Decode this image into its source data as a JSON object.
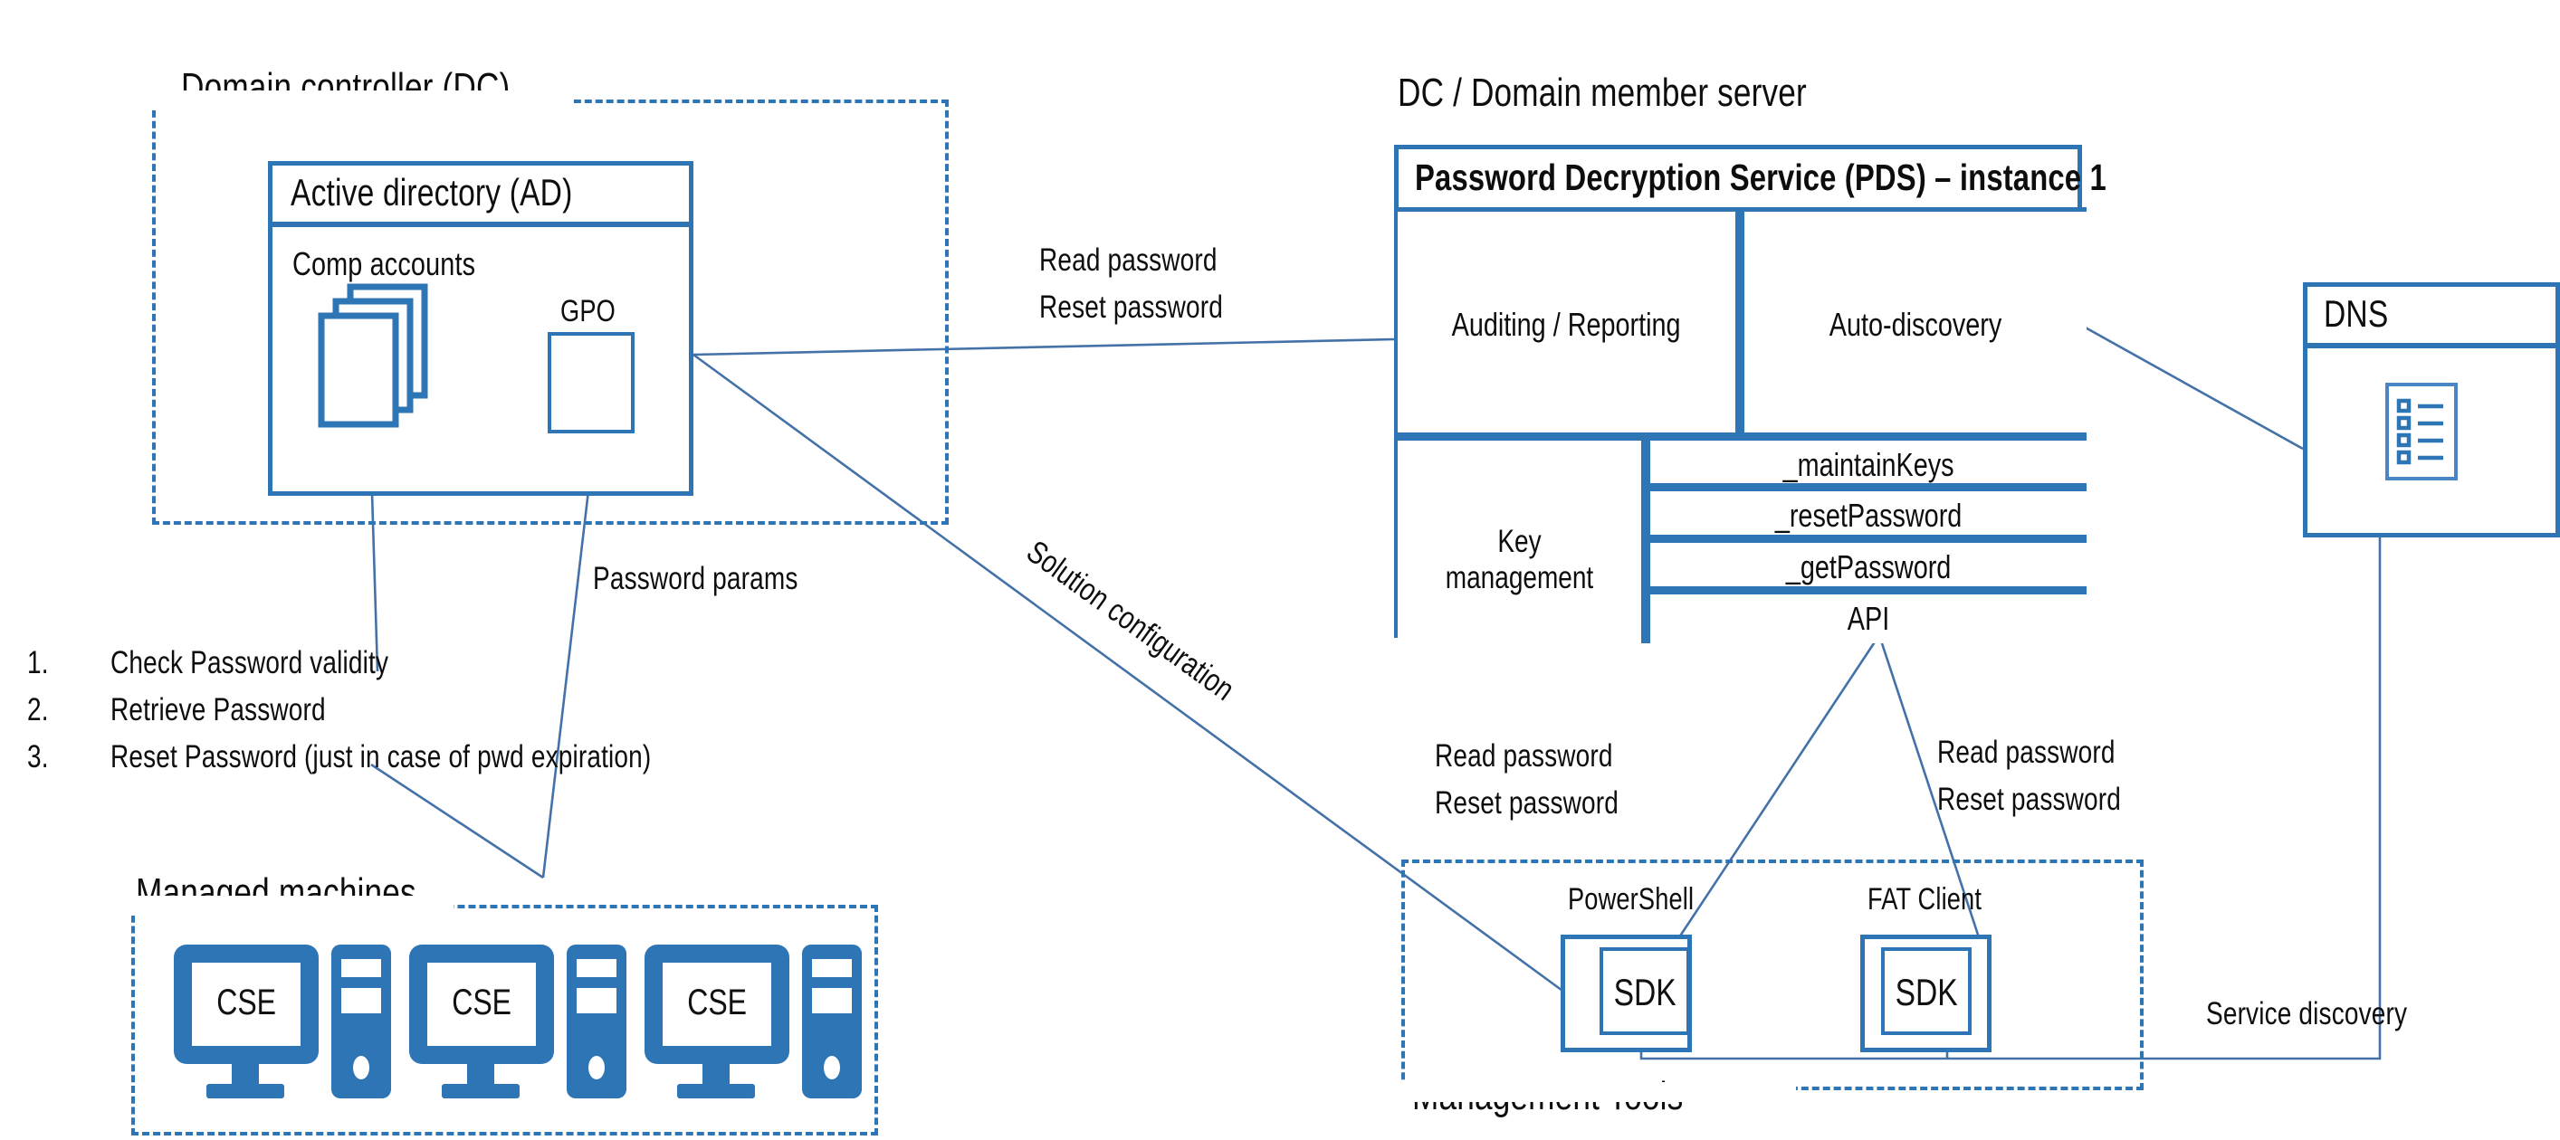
{
  "zones": {
    "domain_controller": {
      "title": "Domain controller (DC)"
    },
    "dc_member_server": {
      "title": "DC / Domain member server"
    },
    "managed_machines": {
      "title": "Managed machines"
    },
    "management_tools": {
      "title": "Management Tools"
    }
  },
  "active_directory": {
    "title": "Active directory (AD)",
    "comp_accounts_label": "Comp accounts",
    "gpo_label": "GPO"
  },
  "pds": {
    "title": "Password Decryption Service (PDS) – instance 1",
    "auditing": "Auditing / Reporting",
    "auto_discovery": "Auto-discovery",
    "key_management": "Key management",
    "api_rows": [
      "_maintainKeys",
      "_resetPassword",
      "_getPassword",
      "API"
    ]
  },
  "dns": {
    "title": "DNS",
    "icon": "list-records-icon"
  },
  "managed_machines": {
    "items": [
      {
        "label": "CSE"
      },
      {
        "label": "CSE"
      },
      {
        "label": "CSE"
      }
    ]
  },
  "management_tools": {
    "items": [
      {
        "name": "PowerShell",
        "sdk_label": "SDK"
      },
      {
        "name": "FAT Client",
        "sdk_label": "SDK"
      }
    ]
  },
  "steps": [
    {
      "num": "1.",
      "text": "Check Password validity"
    },
    {
      "num": "2.",
      "text": "Retrieve Password"
    },
    {
      "num": "3.",
      "text": "Reset Password (just in case of pwd expiration)"
    }
  ],
  "edge_labels": {
    "ad_to_pds_line1": "Read password",
    "ad_to_pds_line2": "Reset password",
    "password_params": "Password params",
    "solution_configuration": "Solution configuration",
    "powershell_line1": "Read password",
    "powershell_line2": "Reset password",
    "fatclient_line1": "Read password",
    "fatclient_line2": "Reset password",
    "service_discovery": "Service discovery"
  },
  "colors": {
    "accent_blue": "#2e75b6",
    "connector_blue": "#4472a8",
    "text_black": "#0d0d0d",
    "background": "#ffffff"
  }
}
